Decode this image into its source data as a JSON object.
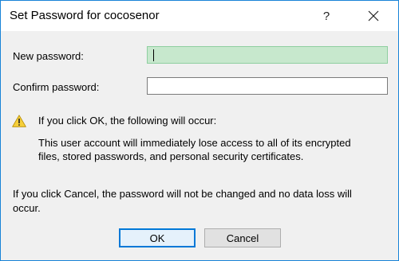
{
  "dialog": {
    "title": "Set Password for cocosenor",
    "help_label": "?"
  },
  "fields": {
    "new_password_label": "New password:",
    "new_password_value": "",
    "confirm_password_label": "Confirm password:",
    "confirm_password_value": ""
  },
  "warning": {
    "icon": "warning-triangle-icon",
    "heading": "If you click OK, the following will occur:",
    "detail_line1": "This user account will immediately lose access to all of its encrypted",
    "detail_line2": "files, stored passwords, and personal security certificates."
  },
  "cancel_note": {
    "line1": "If you click Cancel, the password will not be changed and no data loss will",
    "line2": "occur."
  },
  "buttons": {
    "ok_label": "OK",
    "cancel_label": "Cancel"
  },
  "colors": {
    "window_border": "#1883d7",
    "focused_input": "#c7e8cd",
    "ok_border": "#0078d7",
    "warning_yellow": "#f6cf3a"
  }
}
